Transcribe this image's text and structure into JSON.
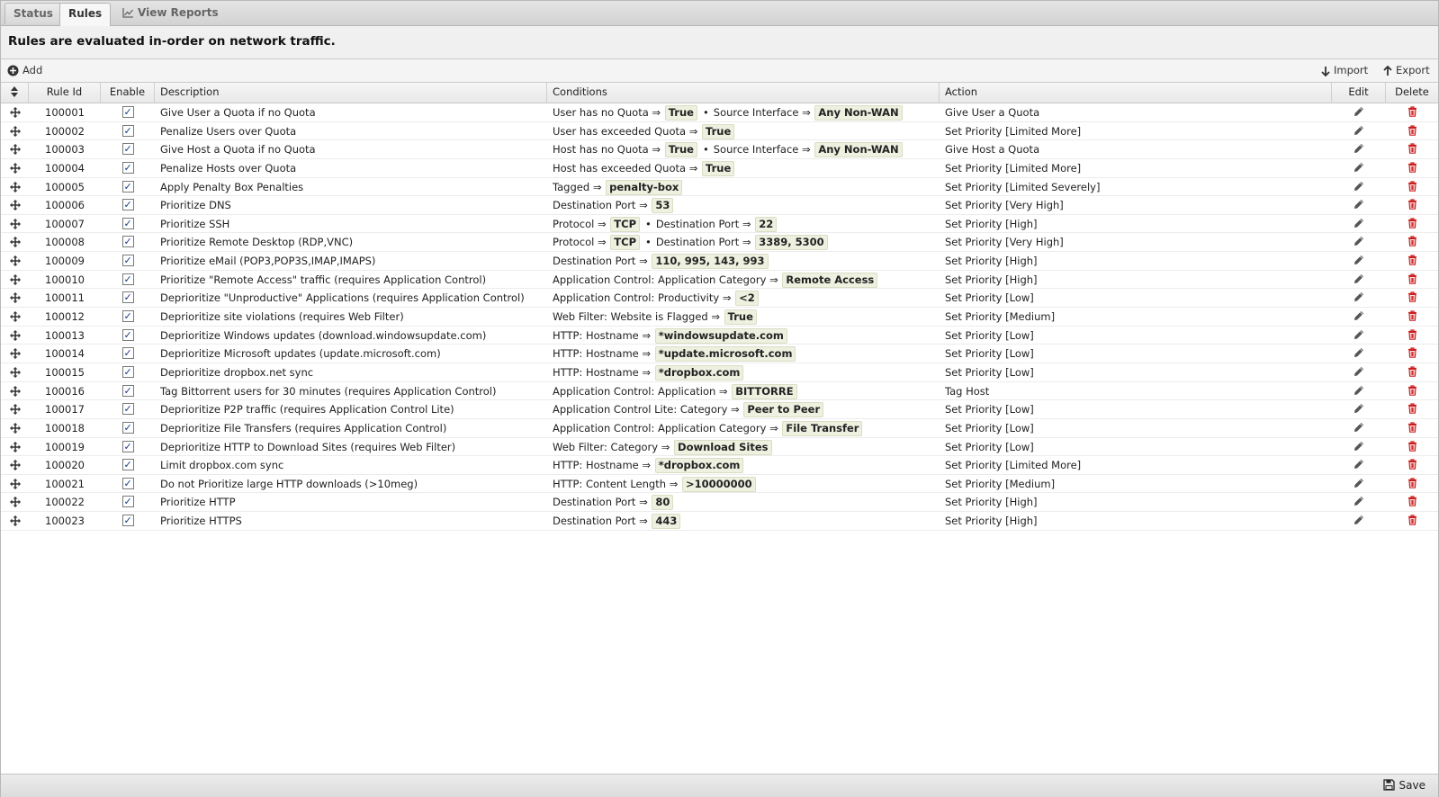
{
  "tabs": [
    {
      "label": "Status"
    },
    {
      "label": "Rules"
    },
    {
      "label": "View Reports"
    }
  ],
  "banner_text": "Rules are evaluated in-order on network traffic.",
  "toolbar": {
    "add_label": "Add",
    "import_label": "Import",
    "export_label": "Export"
  },
  "columns": {
    "id": "Rule Id",
    "enable": "Enable",
    "description": "Description",
    "conditions": "Conditions",
    "action": "Action",
    "edit": "Edit",
    "delete": "Delete"
  },
  "rules": [
    {
      "id": "100001",
      "enabled": true,
      "description": "Give User a Quota if no Quota",
      "conditions": [
        {
          "label": "User has no Quota",
          "value": "True"
        },
        {
          "label": "Source Interface",
          "value": "Any Non-WAN"
        }
      ],
      "action": "Give User a Quota"
    },
    {
      "id": "100002",
      "enabled": true,
      "description": "Penalize Users over Quota",
      "conditions": [
        {
          "label": "User has exceeded Quota",
          "value": "True"
        }
      ],
      "action": "Set Priority [Limited More]"
    },
    {
      "id": "100003",
      "enabled": true,
      "description": "Give Host a Quota if no Quota",
      "conditions": [
        {
          "label": "Host has no Quota",
          "value": "True"
        },
        {
          "label": "Source Interface",
          "value": "Any Non-WAN"
        }
      ],
      "action": "Give Host a Quota"
    },
    {
      "id": "100004",
      "enabled": true,
      "description": "Penalize Hosts over Quota",
      "conditions": [
        {
          "label": "Host has exceeded Quota",
          "value": "True"
        }
      ],
      "action": "Set Priority [Limited More]"
    },
    {
      "id": "100005",
      "enabled": true,
      "description": "Apply Penalty Box Penalties",
      "conditions": [
        {
          "label": "Tagged",
          "value": "penalty-box"
        }
      ],
      "action": "Set Priority [Limited Severely]"
    },
    {
      "id": "100006",
      "enabled": true,
      "description": "Prioritize DNS",
      "conditions": [
        {
          "label": "Destination Port",
          "value": "53"
        }
      ],
      "action": "Set Priority [Very High]"
    },
    {
      "id": "100007",
      "enabled": true,
      "description": "Prioritize SSH",
      "conditions": [
        {
          "label": "Protocol",
          "value": "TCP"
        },
        {
          "label": "Destination Port",
          "value": "22"
        }
      ],
      "action": "Set Priority [High]"
    },
    {
      "id": "100008",
      "enabled": true,
      "description": "Prioritize Remote Desktop (RDP,VNC)",
      "conditions": [
        {
          "label": "Protocol",
          "value": "TCP"
        },
        {
          "label": "Destination Port",
          "value": "3389, 5300"
        }
      ],
      "action": "Set Priority [Very High]"
    },
    {
      "id": "100009",
      "enabled": true,
      "description": "Prioritize eMail (POP3,POP3S,IMAP,IMAPS)",
      "conditions": [
        {
          "label": "Destination Port",
          "value": "110, 995, 143, 993"
        }
      ],
      "action": "Set Priority [High]"
    },
    {
      "id": "100010",
      "enabled": true,
      "description": "Prioritize \"Remote Access\" traffic (requires Application Control)",
      "conditions": [
        {
          "label": "Application Control: Application Category",
          "value": "Remote Access"
        }
      ],
      "action": "Set Priority [High]"
    },
    {
      "id": "100011",
      "enabled": true,
      "description": "Deprioritize \"Unproductive\" Applications (requires Application Control)",
      "conditions": [
        {
          "label": "Application Control: Productivity",
          "value": "<2"
        }
      ],
      "action": "Set Priority [Low]"
    },
    {
      "id": "100012",
      "enabled": true,
      "description": "Deprioritize site violations (requires Web Filter)",
      "conditions": [
        {
          "label": "Web Filter: Website is Flagged",
          "value": "True"
        }
      ],
      "action": "Set Priority [Medium]"
    },
    {
      "id": "100013",
      "enabled": true,
      "description": "Deprioritize Windows updates (download.windowsupdate.com)",
      "conditions": [
        {
          "label": "HTTP: Hostname",
          "value": "*windowsupdate.com"
        }
      ],
      "action": "Set Priority [Low]"
    },
    {
      "id": "100014",
      "enabled": true,
      "description": "Deprioritize Microsoft updates (update.microsoft.com)",
      "conditions": [
        {
          "label": "HTTP: Hostname",
          "value": "*update.microsoft.com"
        }
      ],
      "action": "Set Priority [Low]"
    },
    {
      "id": "100015",
      "enabled": true,
      "description": "Deprioritize dropbox.net sync",
      "conditions": [
        {
          "label": "HTTP: Hostname",
          "value": "*dropbox.com"
        }
      ],
      "action": "Set Priority [Low]"
    },
    {
      "id": "100016",
      "enabled": true,
      "description": "Tag Bittorrent users for 30 minutes (requires Application Control)",
      "conditions": [
        {
          "label": "Application Control: Application",
          "value": "BITTORRE"
        }
      ],
      "action": "Tag Host"
    },
    {
      "id": "100017",
      "enabled": true,
      "description": "Deprioritize P2P traffic (requires Application Control Lite)",
      "conditions": [
        {
          "label": "Application Control Lite: Category",
          "value": "Peer to Peer"
        }
      ],
      "action": "Set Priority [Low]"
    },
    {
      "id": "100018",
      "enabled": true,
      "description": "Deprioritize File Transfers (requires Application Control)",
      "conditions": [
        {
          "label": "Application Control: Application Category",
          "value": "File Transfer"
        }
      ],
      "action": "Set Priority [Low]"
    },
    {
      "id": "100019",
      "enabled": true,
      "description": "Deprioritize HTTP to Download Sites (requires Web Filter)",
      "conditions": [
        {
          "label": "Web Filter: Category",
          "value": "Download Sites"
        }
      ],
      "action": "Set Priority [Low]"
    },
    {
      "id": "100020",
      "enabled": true,
      "description": "Limit dropbox.com sync",
      "conditions": [
        {
          "label": "HTTP: Hostname",
          "value": "*dropbox.com"
        }
      ],
      "action": "Set Priority [Limited More]"
    },
    {
      "id": "100021",
      "enabled": true,
      "description": "Do not Prioritize large HTTP downloads (>10meg)",
      "conditions": [
        {
          "label": "HTTP: Content Length",
          "value": ">10000000"
        }
      ],
      "action": "Set Priority [Medium]"
    },
    {
      "id": "100022",
      "enabled": true,
      "description": "Prioritize HTTP",
      "conditions": [
        {
          "label": "Destination Port",
          "value": "80"
        }
      ],
      "action": "Set Priority [High]"
    },
    {
      "id": "100023",
      "enabled": true,
      "description": "Prioritize HTTPS",
      "conditions": [
        {
          "label": "Destination Port",
          "value": "443"
        }
      ],
      "action": "Set Priority [High]"
    }
  ],
  "condition_arrow": "⇒",
  "condition_separator": "•",
  "footer": {
    "save_label": "Save"
  },
  "colors": {
    "delete_icon": "#cc1f1f",
    "value_bg": "#eef0e0"
  }
}
